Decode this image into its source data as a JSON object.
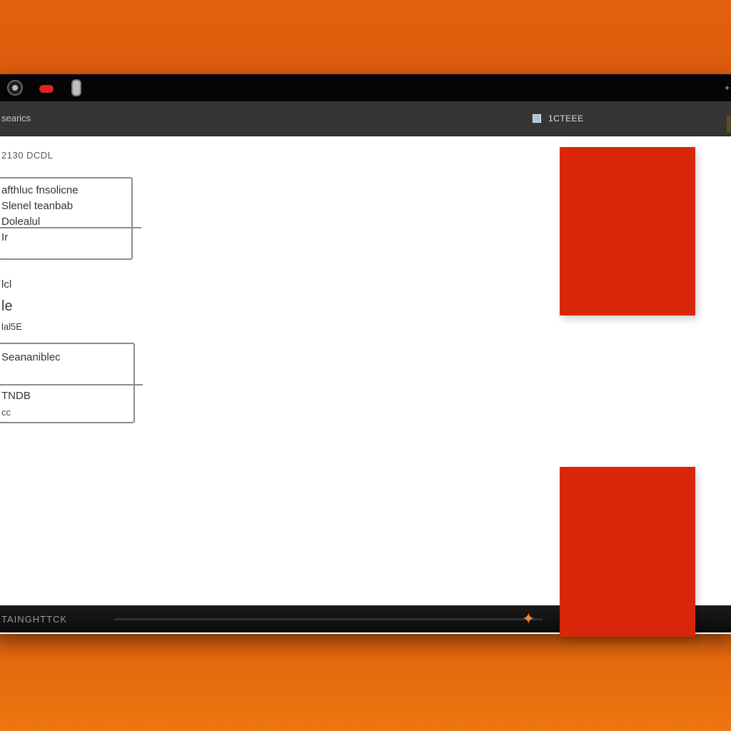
{
  "titlebar": {
    "icons": [
      "camera-icon",
      "record-icon",
      "microphone-icon"
    ],
    "corner_text": "+"
  },
  "toolbar": {
    "left_label": "searics",
    "status_text": "1CTEEE",
    "status_icon": "checkbox-icon"
  },
  "content": {
    "heading": "2130 DCDL",
    "card_primary": {
      "lines": [
        "afthluc fnsolicne",
        "Slenel teanbab",
        "Dolealul",
        "Ir"
      ]
    },
    "meta": [
      "lcl",
      "le",
      "lal5E"
    ],
    "card_secondary": {
      "title": "Seananiblec",
      "value": "TNDB",
      "note": "cc"
    }
  },
  "panels": {
    "color": "#d9260a"
  },
  "bottombar": {
    "label": "TAINGHTTCK",
    "marker_icon": "star-icon"
  },
  "colors": {
    "background_orange": "#e2600e",
    "titlebar": "#050505",
    "toolbar": "#353535",
    "accent_red": "#d9260a"
  }
}
